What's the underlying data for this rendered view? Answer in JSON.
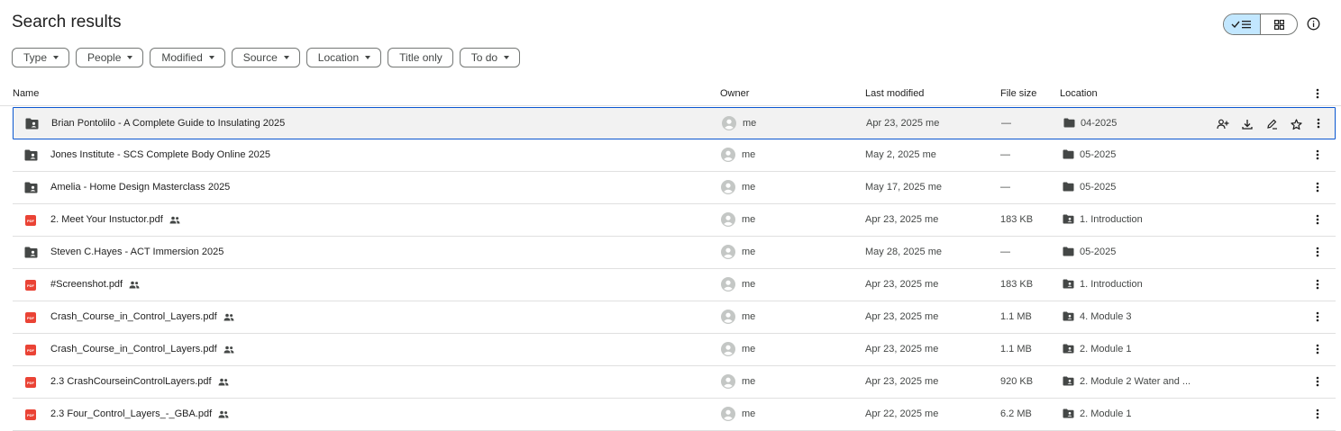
{
  "page": {
    "title": "Search results"
  },
  "filters": [
    "Type",
    "People",
    "Modified",
    "Source",
    "Location",
    "Title only",
    "To do"
  ],
  "columns": {
    "name": "Name",
    "owner": "Owner",
    "modified": "Last modified",
    "size": "File size",
    "location": "Location"
  },
  "rows": [
    {
      "name": "Brian Pontolilo - A Complete Guide to Insulating 2025",
      "type": "shared-folder",
      "shared": false,
      "owner": "me",
      "modified": "Apr 23, 2025 me",
      "size": "—",
      "location": "04-2025",
      "location_type": "folder"
    },
    {
      "name": "Jones Institute - SCS Complete Body Online 2025",
      "type": "shared-folder",
      "shared": false,
      "owner": "me",
      "modified": "May 2, 2025 me",
      "size": "—",
      "location": "05-2025",
      "location_type": "folder"
    },
    {
      "name": "Amelia - Home Design Masterclass 2025",
      "type": "shared-folder",
      "shared": false,
      "owner": "me",
      "modified": "May 17, 2025 me",
      "size": "—",
      "location": "05-2025",
      "location_type": "folder"
    },
    {
      "name": "2. Meet Your Instuctor.pdf",
      "type": "pdf",
      "shared": true,
      "owner": "me",
      "modified": "Apr 23, 2025 me",
      "size": "183 KB",
      "location": "1. Introduction",
      "location_type": "shared-folder"
    },
    {
      "name": "Steven C.Hayes - ACT Immersion 2025",
      "type": "shared-folder",
      "shared": false,
      "owner": "me",
      "modified": "May 28, 2025 me",
      "size": "—",
      "location": "05-2025",
      "location_type": "folder"
    },
    {
      "name": "#Screenshot.pdf",
      "type": "pdf",
      "shared": true,
      "owner": "me",
      "modified": "Apr 23, 2025 me",
      "size": "183 KB",
      "location": "1. Introduction",
      "location_type": "shared-folder"
    },
    {
      "name": "Crash_Course_in_Control_Layers.pdf",
      "type": "pdf",
      "shared": true,
      "owner": "me",
      "modified": "Apr 23, 2025 me",
      "size": "1.1 MB",
      "location": "4. Module 3",
      "location_type": "shared-folder"
    },
    {
      "name": "Crash_Course_in_Control_Layers.pdf",
      "type": "pdf",
      "shared": true,
      "owner": "me",
      "modified": "Apr 23, 2025 me",
      "size": "1.1 MB",
      "location": "2. Module 1",
      "location_type": "shared-folder"
    },
    {
      "name": "2.3 CrashCourseinControlLayers.pdf",
      "type": "pdf",
      "shared": true,
      "owner": "me",
      "modified": "Apr 23, 2025 me",
      "size": "920 KB",
      "location": "2. Module 2 Water and ...",
      "location_type": "shared-folder"
    },
    {
      "name": "2.3 Four_Control_Layers_-_GBA.pdf",
      "type": "pdf",
      "shared": true,
      "owner": "me",
      "modified": "Apr 22, 2025 me",
      "size": "6.2 MB",
      "location": "2. Module 1",
      "location_type": "shared-folder"
    }
  ],
  "pdf_badge": "PDF",
  "colors": {
    "selection_border": "#0b57d0",
    "toggle_active": "#c2e7ff",
    "pdf_red": "#ea4335"
  }
}
